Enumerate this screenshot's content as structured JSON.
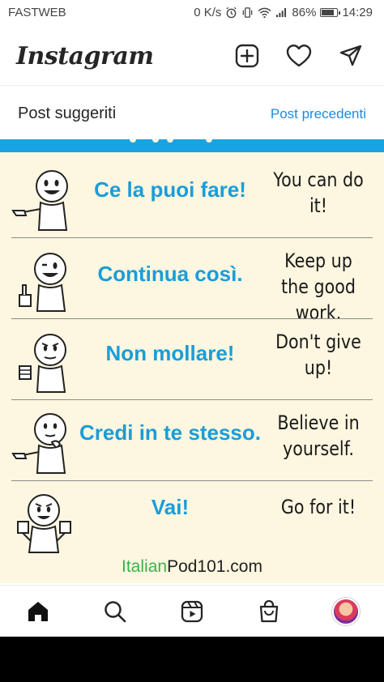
{
  "status": {
    "carrier": "FASTWEB",
    "speed": "0 K/s",
    "battery": "86%",
    "battery_level": 0.86,
    "time": "14:29"
  },
  "header": {
    "logo": "Instagram",
    "icons": [
      "new-post-icon",
      "heart-icon",
      "direct-message-icon"
    ]
  },
  "section": {
    "title": "Post suggeriti",
    "link": "Post precedenti"
  },
  "post": {
    "accent_color": "#1aa3e2",
    "background_color": "#fdf6e0",
    "rows": [
      {
        "italian": "Ce la puoi fare!",
        "english": "You can do it!"
      },
      {
        "italian": "Continua così.",
        "english": "Keep up the good work."
      },
      {
        "italian": "Non mollare!",
        "english": "Don't give up!"
      },
      {
        "italian": "Credi in te stesso.",
        "english": "Believe in yourself."
      },
      {
        "italian": "Vai!",
        "english": "Go for it!"
      }
    ],
    "brand_part1": "Italian",
    "brand_part2": "Pod101.com"
  },
  "bottom_nav": {
    "icons": [
      "home-icon",
      "search-icon",
      "reels-icon",
      "shop-icon",
      "profile-avatar"
    ]
  }
}
